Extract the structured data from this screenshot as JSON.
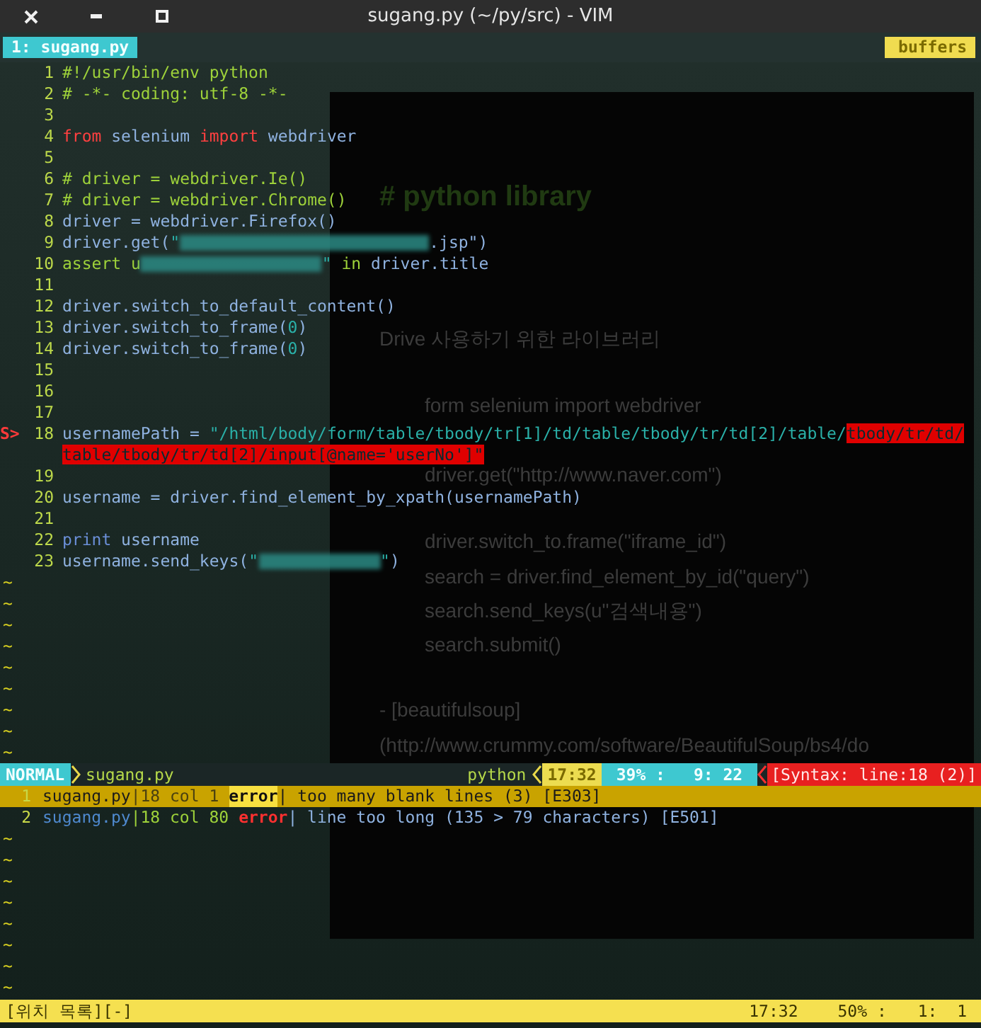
{
  "window": {
    "title": "sugang.py (~/py/src) - VIM"
  },
  "tabs": [
    {
      "label": "1: sugang.py",
      "selected": true
    }
  ],
  "buffers_label": "buffers",
  "lines": [
    {
      "number": "1",
      "tokens": [
        {
          "kind": "comment",
          "text": "#!/usr/bin/env python"
        }
      ]
    },
    {
      "number": "2",
      "tokens": [
        {
          "kind": "comment",
          "text": "# -*- coding: utf-8 -*-"
        }
      ]
    },
    {
      "number": "3"
    },
    {
      "number": "4",
      "tokens": [
        {
          "kind": "keyword",
          "text": "from"
        },
        {
          "kind": "name",
          "text": " selenium "
        },
        {
          "kind": "keyword",
          "text": "import"
        },
        {
          "kind": "name",
          "text": " webdriver"
        }
      ]
    },
    {
      "number": "5"
    },
    {
      "number": "6",
      "tokens": [
        {
          "kind": "comment",
          "text": "# driver = webdriver.Ie()"
        }
      ]
    },
    {
      "number": "7",
      "tokens": [
        {
          "kind": "comment",
          "text": "# driver = webdriver.Chrome()"
        }
      ]
    },
    {
      "number": "8",
      "tokens": [
        {
          "kind": "name",
          "text": "driver = webdriver.Firefox()"
        }
      ]
    },
    {
      "number": "9",
      "tokens": [
        {
          "kind": "name",
          "text": "driver.get("
        },
        {
          "kind": "string",
          "text": "\""
        },
        {
          "kind": "redacted"
        },
        {
          "kind": "name",
          "text": ".jsp\")"
        }
      ]
    },
    {
      "number": "10",
      "tokens": [
        {
          "kind": "statement",
          "text": "assert u"
        },
        {
          "kind": "redacted"
        },
        {
          "kind": "string",
          "text": "\""
        },
        {
          "kind": "statement",
          "text": " in "
        },
        {
          "kind": "name",
          "text": "driver.title"
        }
      ]
    },
    {
      "number": "11"
    },
    {
      "number": "12",
      "tokens": [
        {
          "kind": "name",
          "text": "driver.switch_to_default_content()"
        }
      ]
    },
    {
      "number": "13",
      "tokens": [
        {
          "kind": "name",
          "text": "driver.switch_to_frame("
        },
        {
          "kind": "string",
          "text": "0"
        },
        {
          "kind": "name",
          "text": ")"
        }
      ]
    },
    {
      "number": "14",
      "tokens": [
        {
          "kind": "name",
          "text": "driver.switch_to_frame("
        },
        {
          "kind": "string",
          "text": "0"
        },
        {
          "kind": "name",
          "text": ")"
        }
      ]
    },
    {
      "number": "15"
    },
    {
      "number": "16"
    },
    {
      "number": "17"
    },
    {
      "number": "18",
      "sign": "S>",
      "tokens": [
        {
          "kind": "name",
          "text": "usernamePath = "
        },
        {
          "kind": "string",
          "text": "\"/html/body/form/table/tbody/tr[1]/td/table/tbody/tr/td[2]/table/"
        },
        {
          "kind": "error",
          "text": "tbody/tr/td/"
        }
      ],
      "continuation": [
        {
          "kind": "error",
          "text": "table/tbody/tr/td[2]/input[@name='userNo']\""
        }
      ]
    },
    {
      "number": "19"
    },
    {
      "number": "20",
      "tokens": [
        {
          "kind": "name",
          "text": "username = driver.find_element_by_xpath(usernamePath)"
        }
      ]
    },
    {
      "number": "21"
    },
    {
      "number": "22",
      "tokens": [
        {
          "kind": "builtin",
          "text": "print"
        },
        {
          "kind": "name",
          "text": " username"
        }
      ]
    },
    {
      "number": "23",
      "tokens": [
        {
          "kind": "name",
          "text": "username.send_keys("
        },
        {
          "kind": "string",
          "text": "\""
        },
        {
          "kind": "redacted"
        },
        {
          "kind": "string",
          "text": "\""
        },
        {
          "kind": "name",
          "text": ")"
        }
      ]
    }
  ],
  "filler_top": [
    "~",
    "~",
    "~",
    "~",
    "~",
    "~",
    "~",
    "~",
    "~"
  ],
  "status": {
    "mode": "NORMAL",
    "file": "sugang.py",
    "filetype": "python",
    "time": "17:32",
    "percent": "39% :",
    "position": "9: 22",
    "syntax": "[Syntax: line:18 (2)]"
  },
  "quickfix": [
    {
      "index": "1",
      "file": "sugang.py",
      "location": "|18 col 1",
      "type": "error",
      "message": "| too many blank lines (3) [E303]",
      "selected": true
    },
    {
      "index": "2",
      "file": "sugang.py",
      "location": "|18 col 80",
      "type": "error",
      "message": "| line too long (135 > 79 characters) [E501]",
      "selected": false
    }
  ],
  "filler_bottom": [
    "~",
    "~",
    "~",
    "~",
    "~",
    "~",
    "~",
    "~"
  ],
  "bottom_status": {
    "title": "[위치 목록][-]",
    "time": "17:32",
    "percent": "50% :",
    "position": "1:  1"
  },
  "background_window": {
    "lines": [
      {
        "kind": "heading",
        "text": "# python library"
      },
      {
        "kind": "text",
        "text": "Drive 사용하기 위한 라이브러리"
      },
      {
        "kind": "code",
        "text": "form selenium import webdriver"
      },
      {
        "kind": "code",
        "text": "driver.get(\"http://www.naver.com\")"
      },
      {
        "kind": "code",
        "text": "driver.switch_to.frame(\"iframe_id\")"
      },
      {
        "kind": "code",
        "text": "search = driver.find_element_by_id(\"query\")"
      },
      {
        "kind": "code",
        "text": "search.send_keys(u\"검색내용\")"
      },
      {
        "kind": "code",
        "text": "search.submit()"
      },
      {
        "kind": "text",
        "text": "- [beautifulsoup]"
      },
      {
        "kind": "text",
        "text": "(http://www.crummy.com/software/BeautifulSoup/bs4/do"
      }
    ]
  }
}
